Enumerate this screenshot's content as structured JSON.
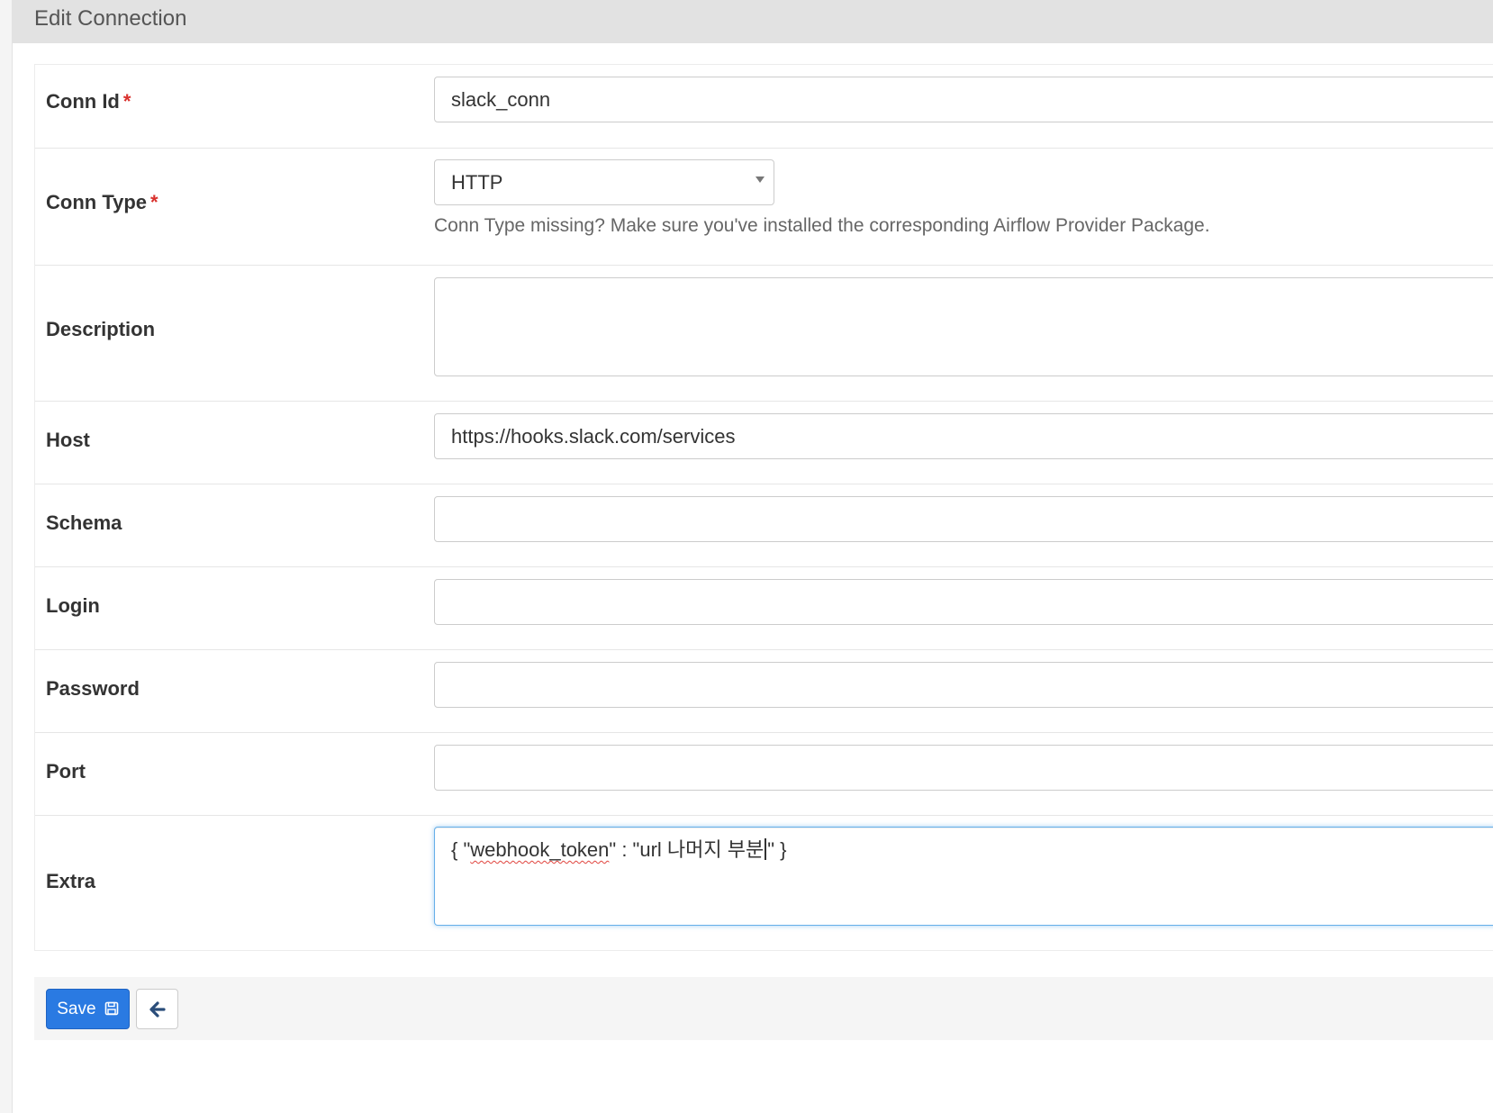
{
  "panel": {
    "title": "Edit Connection"
  },
  "required_marker": "*",
  "fields": {
    "conn_id": {
      "label": "Conn Id",
      "value": "slack_conn"
    },
    "conn_type": {
      "label": "Conn Type",
      "selected": "HTTP",
      "help": "Conn Type missing? Make sure you've installed the corresponding Airflow Provider Package."
    },
    "description": {
      "label": "Description",
      "value": ""
    },
    "host": {
      "label": "Host",
      "value": "https://hooks.slack.com/services"
    },
    "schema": {
      "label": "Schema",
      "value": ""
    },
    "login": {
      "label": "Login",
      "value": ""
    },
    "password": {
      "label": "Password",
      "value": ""
    },
    "port": {
      "label": "Port",
      "value": ""
    },
    "extra": {
      "label": "Extra",
      "value_prefix": "{ \"",
      "value_token": "webhook_token",
      "value_middle": "\" : \"url 나머지 부분",
      "value_suffix": "\" }"
    }
  },
  "actions": {
    "save_label": "Save"
  },
  "icons": {
    "save": "floppy-disk-icon",
    "back": "arrow-left-icon",
    "dropdown": "caret-down-icon"
  },
  "colors": {
    "primary": "#2a7ae2",
    "required": "#d9302c",
    "focus": "#66afe9",
    "header_bg": "#e2e2e2"
  }
}
